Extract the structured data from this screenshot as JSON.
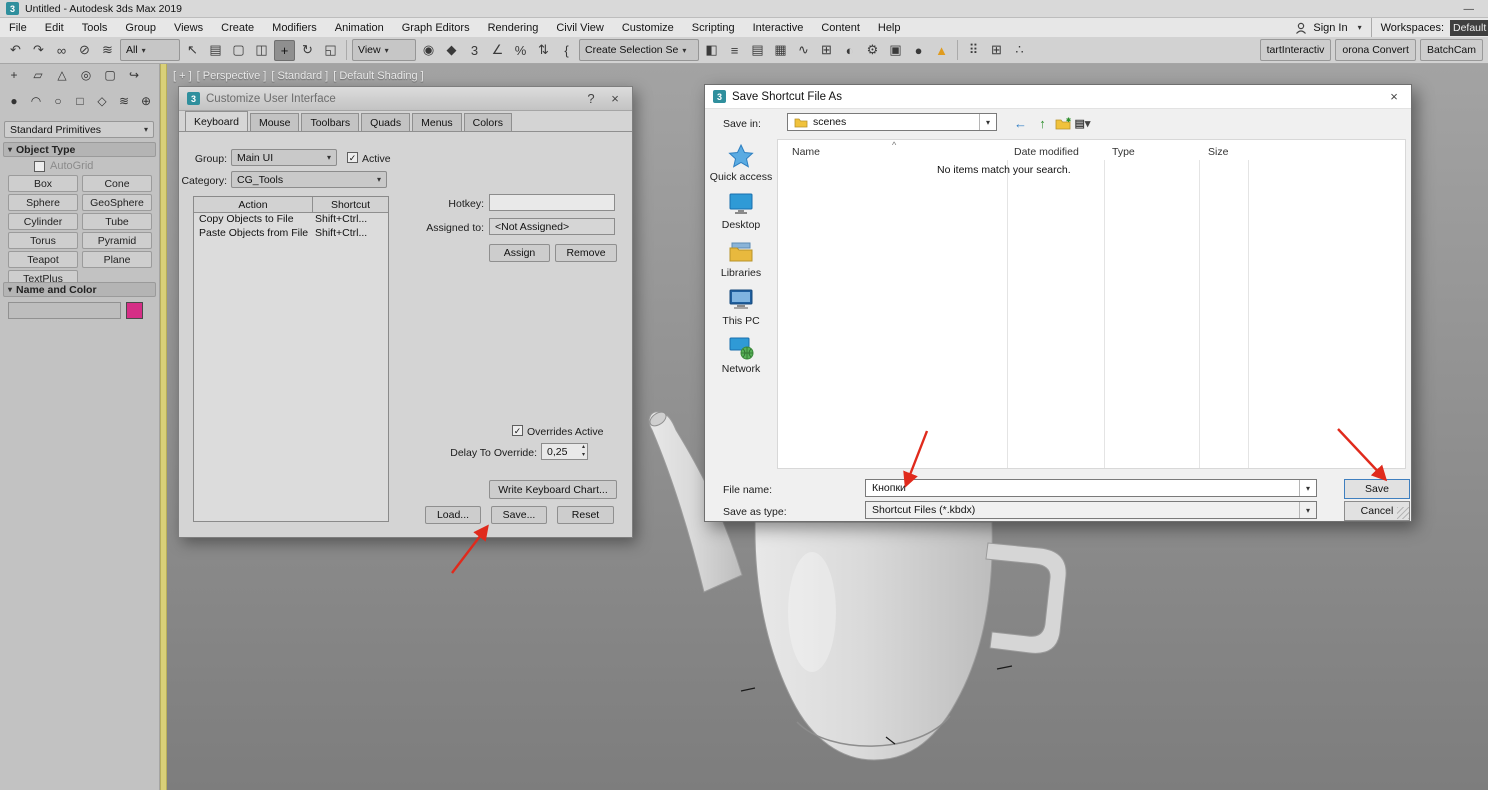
{
  "colors": {
    "arrow": "#e02a1c",
    "name_color_swatch": "#d52e86"
  },
  "glyphs": {
    "close": "×",
    "help": "?",
    "caret": "▾",
    "minimize": "—",
    "check": "✓",
    "sort_up": "^",
    "spinner_up": "▴",
    "spinner_down": "▾",
    "rollout_open": "▾"
  },
  "window": {
    "title": "Untitled - Autodesk 3ds Max 2019"
  },
  "menu_bar": {
    "items": [
      {
        "name": "menu-file",
        "label": "File"
      },
      {
        "name": "menu-edit",
        "label": "Edit"
      },
      {
        "name": "menu-tools",
        "label": "Tools"
      },
      {
        "name": "menu-group",
        "label": "Group"
      },
      {
        "name": "menu-views",
        "label": "Views"
      },
      {
        "name": "menu-create",
        "label": "Create"
      },
      {
        "name": "menu-modifiers",
        "label": "Modifiers"
      },
      {
        "name": "menu-animation",
        "label": "Animation"
      },
      {
        "name": "menu-graph-editors",
        "label": "Graph Editors"
      },
      {
        "name": "menu-rendering",
        "label": "Rendering"
      },
      {
        "name": "menu-civil-view",
        "label": "Civil View"
      },
      {
        "name": "menu-customize",
        "label": "Customize"
      },
      {
        "name": "menu-scripting",
        "label": "Scripting"
      },
      {
        "name": "menu-interactive",
        "label": "Interactive"
      },
      {
        "name": "menu-content",
        "label": "Content"
      },
      {
        "name": "menu-help",
        "label": "Help"
      }
    ],
    "sign_in": "Sign In",
    "workspaces_label": "Workspaces:",
    "workspaces_value": "Default"
  },
  "toolbar": {
    "icons_a": [
      {
        "name": "undo-icon",
        "glyph": "↶"
      },
      {
        "name": "redo-icon",
        "glyph": "↷"
      },
      {
        "name": "select-link-icon",
        "glyph": "∞"
      },
      {
        "name": "unlink-icon",
        "glyph": "⊘"
      },
      {
        "name": "bind-spacewarp-icon",
        "glyph": "≋"
      }
    ],
    "filter_value": "All",
    "icons_b": [
      {
        "name": "select-object-icon",
        "glyph": "↖"
      },
      {
        "name": "select-by-name-icon",
        "glyph": "▤"
      },
      {
        "name": "rect-selection-region-icon",
        "glyph": "▢"
      },
      {
        "name": "window-crossing-icon",
        "glyph": "◫"
      },
      {
        "name": "select-move-icon",
        "glyph": "+",
        "cls": "pressed"
      },
      {
        "name": "select-rotate-icon",
        "glyph": "↻"
      },
      {
        "name": "select-scale-icon",
        "glyph": "◱"
      }
    ],
    "view_value": "View",
    "icons_c": [
      {
        "name": "pivot-center-icon",
        "glyph": "◉"
      },
      {
        "name": "select-manipulate-icon",
        "glyph": "◆"
      },
      {
        "name": "snap-toggle-icon",
        "glyph": "3"
      },
      {
        "name": "angle-snap-icon",
        "glyph": "∠"
      },
      {
        "name": "percent-snap-icon",
        "glyph": "%"
      },
      {
        "name": "spinner-snap-icon",
        "glyph": "⇅"
      },
      {
        "name": "named-selection-icon",
        "glyph": "{"
      }
    ],
    "selection_set_value": "Create Selection Se",
    "icons_d": [
      {
        "name": "mirror-icon",
        "glyph": "◧"
      },
      {
        "name": "align-icon",
        "glyph": "≡"
      },
      {
        "name": "layer-manager-icon",
        "glyph": "▤"
      },
      {
        "name": "ribbon-toggle-icon",
        "glyph": "▦"
      },
      {
        "name": "curve-editor-icon",
        "glyph": "∿"
      },
      {
        "name": "schematic-view-icon",
        "glyph": "⊞"
      },
      {
        "name": "material-editor-icon",
        "glyph": "◐"
      },
      {
        "name": "render-setup-icon",
        "glyph": "⚙"
      },
      {
        "name": "rendered-frame-icon",
        "glyph": "▣"
      },
      {
        "name": "render-production-icon",
        "glyph": "●"
      },
      {
        "name": "warning-icon",
        "glyph": "▲",
        "cls": "warn"
      }
    ],
    "icons_e": [
      {
        "name": "dots-grid-icon",
        "glyph": "⠿"
      },
      {
        "name": "measure-icon",
        "glyph": "⊞"
      },
      {
        "name": "scatter-icon",
        "glyph": "∴"
      }
    ],
    "plugin_buttons": [
      {
        "name": "start-interactive-button",
        "label": "tartInteractiv"
      },
      {
        "name": "corona-converter-button",
        "label": "orona Convert"
      },
      {
        "name": "batchcam-button",
        "label": "BatchCam"
      }
    ]
  },
  "command_panel": {
    "tabs": [
      {
        "name": "create-tab-icon",
        "glyph": "+"
      },
      {
        "name": "modify-tab-icon",
        "glyph": "▱"
      },
      {
        "name": "hierarchy-tab-icon",
        "glyph": "△"
      },
      {
        "name": "motion-tab-icon",
        "glyph": "◎"
      },
      {
        "name": "display-tab-icon",
        "glyph": "▢"
      },
      {
        "name": "utilities-tab-icon",
        "glyph": "↪"
      }
    ],
    "categories": [
      {
        "name": "geometry-category-icon",
        "glyph": "●"
      },
      {
        "name": "shapes-category-icon",
        "glyph": "◠"
      },
      {
        "name": "lights-category-icon",
        "glyph": "○"
      },
      {
        "name": "cameras-category-icon",
        "glyph": "□"
      },
      {
        "name": "helpers-category-icon",
        "glyph": "◇"
      },
      {
        "name": "spacewarps-category-icon",
        "glyph": "≋"
      },
      {
        "name": "systems-category-icon",
        "glyph": "⊕"
      }
    ],
    "dropdown_value": "Standard Primitives",
    "object_type": {
      "title": "Object Type",
      "autogrid": "AutoGrid",
      "buttons": [
        "Box",
        "Cone",
        "Sphere",
        "GeoSphere",
        "Cylinder",
        "Tube",
        "Torus",
        "Pyramid",
        "Teapot",
        "Plane",
        "TextPlus"
      ]
    },
    "name_color": {
      "title": "Name and Color"
    }
  },
  "viewport": {
    "label_segments": [
      "[ + ]",
      "[ Perspective ]",
      "[ Standard ]",
      "[ Default Shading ]"
    ]
  },
  "customize_dialog": {
    "title": "Customize User Interface",
    "tabs": [
      {
        "name": "tab-keyboard",
        "label": "Keyboard",
        "cls": "active"
      },
      {
        "name": "tab-mouse",
        "label": "Mouse"
      },
      {
        "name": "tab-toolbars",
        "label": "Toolbars"
      },
      {
        "name": "tab-quads",
        "label": "Quads"
      },
      {
        "name": "tab-menus",
        "label": "Menus"
      },
      {
        "name": "tab-colors",
        "label": "Colors"
      }
    ],
    "group_label": "Group:",
    "group_value": "Main UI",
    "active_label": "Active",
    "category_label": "Category:",
    "category_value": "CG_Tools",
    "table": {
      "headers": [
        "Action",
        "Shortcut"
      ],
      "rows": [
        [
          "Copy Objects to File",
          "Shift+Ctrl..."
        ],
        [
          "Paste Objects from File",
          "Shift+Ctrl..."
        ]
      ]
    },
    "hotkey_label": "Hotkey:",
    "hotkey_value": "",
    "assigned_label": "Assigned to:",
    "assigned_value": "<Not Assigned>",
    "assign_button": "Assign",
    "remove_button": "Remove",
    "overrides_label": "Overrides Active",
    "delay_label": "Delay To Override:",
    "delay_value": "0,25",
    "write_chart_button": "Write Keyboard Chart...",
    "load_button": "Load...",
    "save_button": "Save...",
    "reset_button": "Reset"
  },
  "save_dialog": {
    "title": "Save Shortcut File As",
    "save_in_label": "Save in:",
    "save_in_value": "scenes",
    "sidebar_labels": [
      "Quick access",
      "Desktop",
      "Libraries",
      "This PC",
      "Network"
    ],
    "columns": [
      "Name",
      "Date modified",
      "Type",
      "Size"
    ],
    "empty_message": "No items match your search.",
    "file_name_label": "File name:",
    "file_name_value": "Кнопки",
    "save_as_type_label": "Save as type:",
    "save_as_type_value": "Shortcut Files (*.kbdx)",
    "save_button": "Save",
    "cancel_button": "Cancel"
  }
}
